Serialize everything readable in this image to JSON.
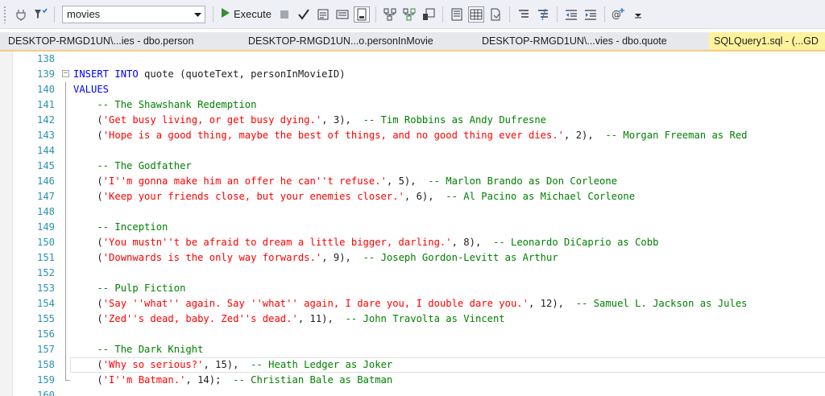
{
  "toolbar": {
    "database": "movies",
    "execute_label": "Execute",
    "icons": [
      "connect-icon",
      "filter-icon",
      "execute-icon",
      "stop-icon",
      "parse-icon",
      "display-plan-icon",
      "query-options-icon",
      "intellisense-icon",
      "results-to-text-icon",
      "results-to-grid-icon",
      "results-to-file-icon",
      "comment-icon",
      "uncomment-icon",
      "decrease-indent-icon",
      "increase-indent-icon",
      "specify-values-icon"
    ]
  },
  "tabs": [
    {
      "label": "DESKTOP-RMGD1UN\\...ies - dbo.person"
    },
    {
      "label": "DESKTOP-RMGD1UN...o.personInMovie"
    },
    {
      "label": "DESKTOP-RMGD1UN\\...vies - dbo.quote"
    },
    {
      "label": "SQLQuery1.sql - (...GD"
    }
  ],
  "editor": {
    "lines": [
      {
        "num": "138",
        "segs": []
      },
      {
        "num": "139",
        "segs": [
          {
            "t": "kw",
            "v": "INSERT INTO"
          },
          {
            "t": "pl",
            "v": " quote (quoteText, personInMovieID)"
          }
        ]
      },
      {
        "num": "140",
        "segs": [
          {
            "t": "kw",
            "v": "VALUES"
          }
        ]
      },
      {
        "num": "141",
        "segs": [
          {
            "t": "cm",
            "v": "    -- The Shawshank Redemption"
          }
        ]
      },
      {
        "num": "142",
        "segs": [
          {
            "t": "pl",
            "v": "    ("
          },
          {
            "t": "str",
            "v": "'Get busy living, or get busy dying.'"
          },
          {
            "t": "pl",
            "v": ", 3),  "
          },
          {
            "t": "cm",
            "v": "-- Tim Robbins as Andy Dufresne"
          }
        ]
      },
      {
        "num": "143",
        "segs": [
          {
            "t": "pl",
            "v": "    ("
          },
          {
            "t": "str",
            "v": "'Hope is a good thing, maybe the best of things, and no good thing ever dies.'"
          },
          {
            "t": "pl",
            "v": ", 2),  "
          },
          {
            "t": "cm",
            "v": "-- Morgan Freeman as Red"
          }
        ]
      },
      {
        "num": "144",
        "segs": []
      },
      {
        "num": "145",
        "segs": [
          {
            "t": "cm",
            "v": "    -- The Godfather"
          }
        ]
      },
      {
        "num": "146",
        "segs": [
          {
            "t": "pl",
            "v": "    ("
          },
          {
            "t": "str",
            "v": "'I''m gonna make him an offer he can''t refuse.'"
          },
          {
            "t": "pl",
            "v": ", 5),  "
          },
          {
            "t": "cm",
            "v": "-- Marlon Brando as Don Corleone"
          }
        ]
      },
      {
        "num": "147",
        "segs": [
          {
            "t": "pl",
            "v": "    ("
          },
          {
            "t": "str",
            "v": "'Keep your friends close, but your enemies closer.'"
          },
          {
            "t": "pl",
            "v": ", 6),  "
          },
          {
            "t": "cm",
            "v": "-- Al Pacino as Michael Corleone"
          }
        ]
      },
      {
        "num": "148",
        "segs": []
      },
      {
        "num": "149",
        "segs": [
          {
            "t": "cm",
            "v": "    -- Inception"
          }
        ]
      },
      {
        "num": "150",
        "segs": [
          {
            "t": "pl",
            "v": "    ("
          },
          {
            "t": "str",
            "v": "'You mustn''t be afraid to dream a little bigger, darling.'"
          },
          {
            "t": "pl",
            "v": ", 8),  "
          },
          {
            "t": "cm",
            "v": "-- Leonardo DiCaprio as Cobb"
          }
        ]
      },
      {
        "num": "151",
        "segs": [
          {
            "t": "pl",
            "v": "    ("
          },
          {
            "t": "str",
            "v": "'Downwards is the only way forwards.'"
          },
          {
            "t": "pl",
            "v": ", 9),  "
          },
          {
            "t": "cm",
            "v": "-- Joseph Gordon-Levitt as Arthur"
          }
        ]
      },
      {
        "num": "152",
        "segs": []
      },
      {
        "num": "153",
        "segs": [
          {
            "t": "cm",
            "v": "    -- Pulp Fiction"
          }
        ]
      },
      {
        "num": "154",
        "segs": [
          {
            "t": "pl",
            "v": "    ("
          },
          {
            "t": "str",
            "v": "'Say ''what'' again. Say ''what'' again, I dare you, I double dare you.'"
          },
          {
            "t": "pl",
            "v": ", 12),  "
          },
          {
            "t": "cm",
            "v": "-- Samuel L. Jackson as Jules"
          }
        ]
      },
      {
        "num": "155",
        "segs": [
          {
            "t": "pl",
            "v": "    ("
          },
          {
            "t": "str",
            "v": "'Zed''s dead, baby. Zed''s dead.'"
          },
          {
            "t": "pl",
            "v": ", 11),  "
          },
          {
            "t": "cm",
            "v": "-- John Travolta as Vincent"
          }
        ]
      },
      {
        "num": "156",
        "segs": []
      },
      {
        "num": "157",
        "segs": [
          {
            "t": "cm",
            "v": "    -- The Dark Knight"
          }
        ]
      },
      {
        "num": "158",
        "segs": [
          {
            "t": "pl",
            "v": "    ("
          },
          {
            "t": "str",
            "v": "'Why so serious?'"
          },
          {
            "t": "pl",
            "v": ", 15),  "
          },
          {
            "t": "cm",
            "v": "-- Heath Ledger as Joker"
          }
        ]
      },
      {
        "num": "159",
        "segs": [
          {
            "t": "pl",
            "v": "    ("
          },
          {
            "t": "str",
            "v": "'I''m Batman.'"
          },
          {
            "t": "pl",
            "v": ", 14);  "
          },
          {
            "t": "cm",
            "v": "-- Christian Bale as Batman"
          }
        ]
      },
      {
        "num": "160",
        "segs": []
      }
    ],
    "colors": {
      "keyword": "#0000ff",
      "string": "#ff0000",
      "comment": "#008000",
      "line_number": "#2b91af",
      "active_tab": "#fff29d"
    }
  }
}
